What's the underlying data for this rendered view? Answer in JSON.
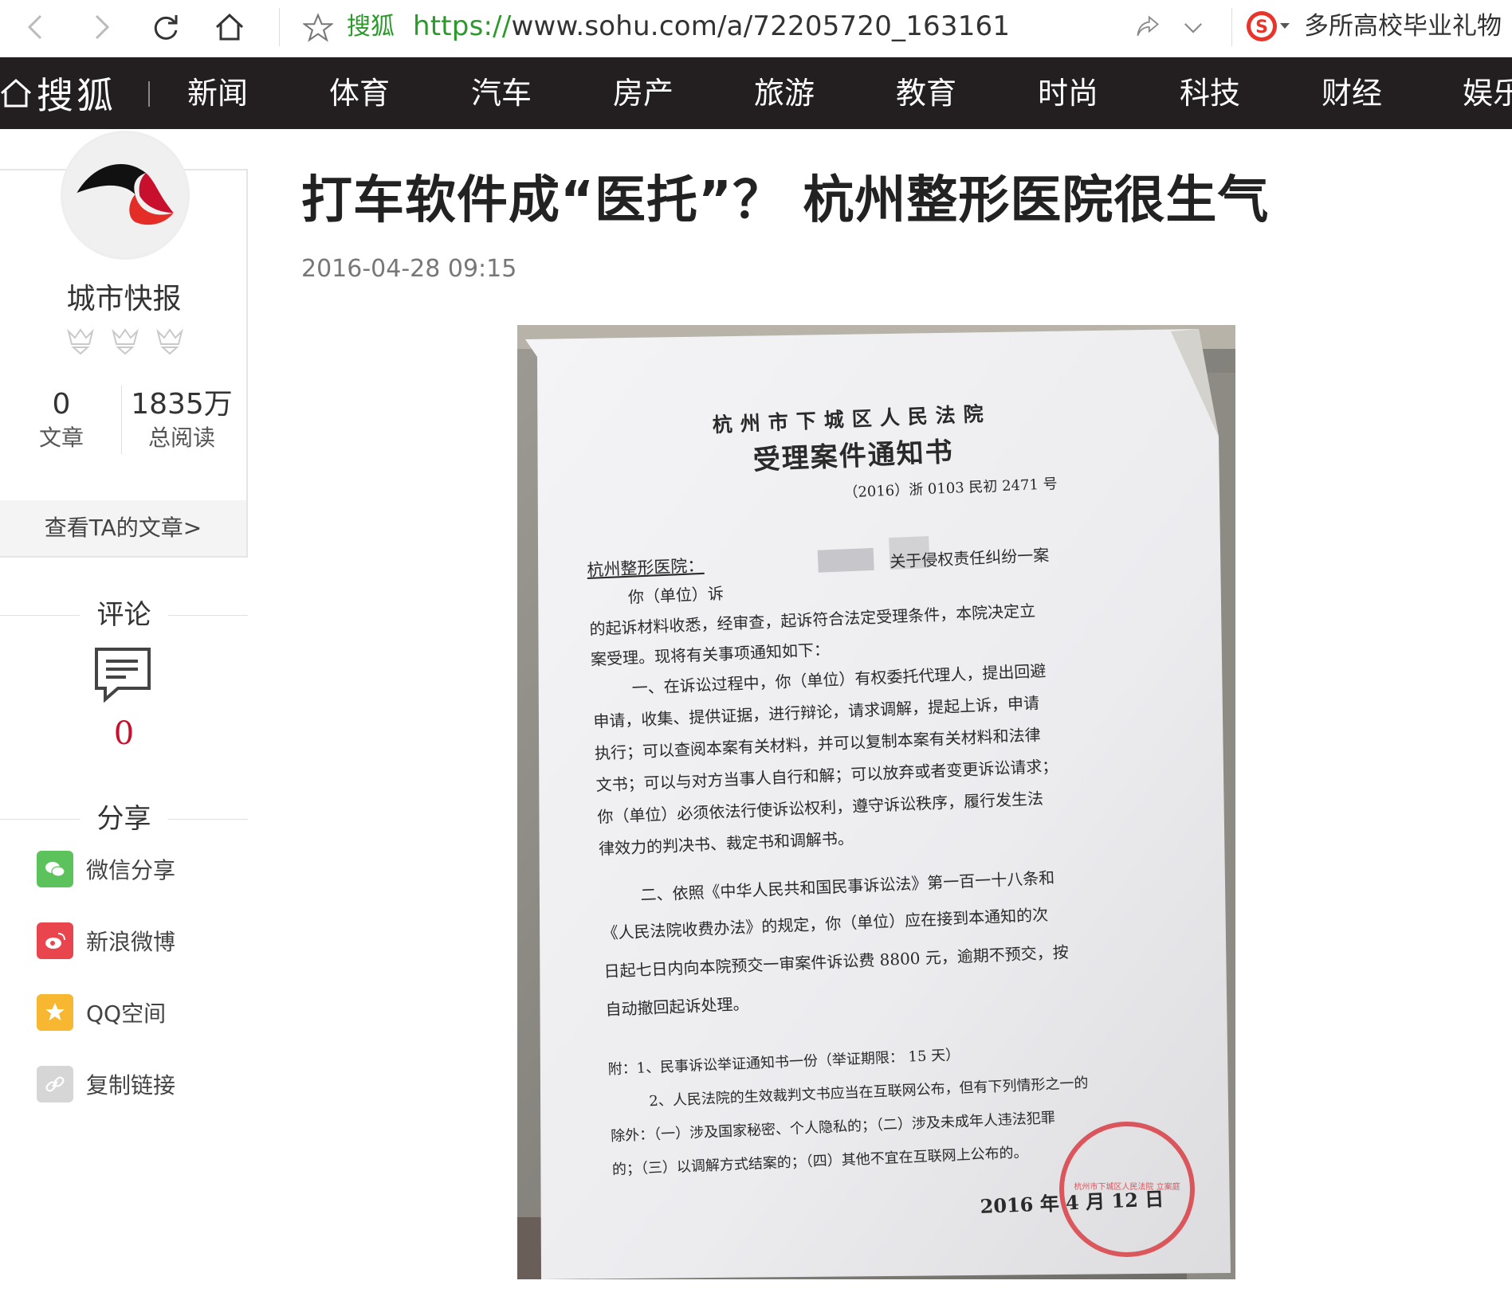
{
  "browser": {
    "site_name": "搜狐",
    "url_protocol": "https://",
    "url_rest": "www.sohu.com/a/72205720_163161",
    "promo_text": "多所高校毕业礼物"
  },
  "channel_nav": {
    "logo_text": "搜狐",
    "items": [
      "新闻",
      "体育",
      "汽车",
      "房产",
      "旅游",
      "教育",
      "时尚",
      "科技",
      "财经",
      "娱乐"
    ]
  },
  "author": {
    "name": "城市快报",
    "articles_count": "0",
    "articles_label": "文章",
    "reads_count": "1835万",
    "reads_label": "总阅读",
    "view_link": "查看TA的文章>"
  },
  "comments": {
    "heading": "评论",
    "count": "0"
  },
  "share": {
    "heading": "分享",
    "items": [
      {
        "label": "微信分享",
        "icon": "wechat-icon",
        "color": "#5cc35c"
      },
      {
        "label": "新浪微博",
        "icon": "weibo-icon",
        "color": "#e8454f"
      },
      {
        "label": "QQ空间",
        "icon": "qzone-icon",
        "color": "#f7b731"
      },
      {
        "label": "复制链接",
        "icon": "link-icon",
        "color": "#d6d6d6"
      }
    ]
  },
  "article": {
    "title": "打车软件成“医托”？ 杭州整形医院很生气",
    "date": "2016-04-28 09:15"
  },
  "document_photo": {
    "court": "杭州市下城区人民法院",
    "doc_title": "受理案件通知书",
    "case_no": "（2016）浙 0103 民初 2471 号",
    "addressee": "杭州整形医院：",
    "lines": [
      "你（单位）诉",
      "关于侵权责任纠纷一案",
      "的起诉材料收悉，经审查，起诉符合法定受理条件，本院决定立",
      "案受理。现将有关事项通知如下：",
      "一、在诉讼过程中，你（单位）有权委托代理人，提出回避",
      "申请，收集、提供证据，进行辩论，请求调解，提起上诉，申请",
      "执行；可以查阅本案有关材料，并可以复制本案有关材料和法律",
      "文书；可以与对方当事人自行和解；可以放弃或者变更诉讼请求；",
      "你（单位）必须依法行使诉讼权利，遵守诉讼秩序，履行发生法",
      "律效力的判决书、裁定书和调解书。",
      "二、依照《中华人民共和国民事诉讼法》第一百一十八条和",
      "《人民法院收费办法》的规定，你（单位）应在接到本通知的次",
      "日起七日内向本院预交一审案件诉讼费 8800 元，逾期不预交，按",
      "自动撤回起诉处理。",
      "附：1、民事诉讼举证通知书一份（举证期限： 15 天）",
      "2、人民法院的生效裁判文书应当在互联网公布，但有下列情形之一的",
      "除外：（一）涉及国家秘密、个人隐私的；（二）涉及未成年人违法犯罪",
      "的；（三）以调解方式结案的；（四）其他不宜在互联网上公布的。"
    ],
    "signature_date": "2016 年 4 月 12 日",
    "stamp_text": "杭州市下城区人民法院 立案庭",
    "stamp_color": "#d8343a"
  }
}
